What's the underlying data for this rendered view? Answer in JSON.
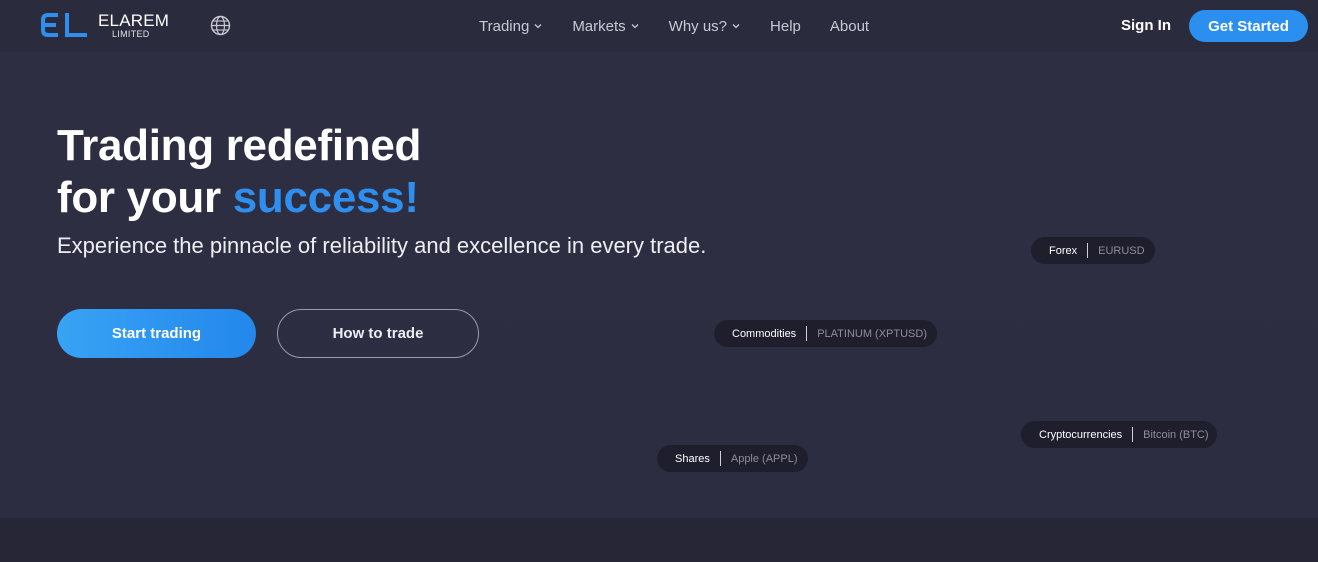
{
  "brand": {
    "name": "ELAREM",
    "sub": "LIMITED",
    "color": "#2f8fee"
  },
  "nav": {
    "items": [
      {
        "label": "Trading",
        "dropdown": true
      },
      {
        "label": "Markets",
        "dropdown": true
      },
      {
        "label": "Why us?",
        "dropdown": true
      },
      {
        "label": "Help",
        "dropdown": false
      },
      {
        "label": "About",
        "dropdown": false
      }
    ],
    "sign_in": "Sign In",
    "get_started": "Get Started",
    "language_icon": "globe-icon"
  },
  "hero": {
    "title_line1": "Trading redefined",
    "title_line2_prefix": "for your ",
    "title_line2_accent": "success!",
    "subtitle": "Experience the pinnacle of reliability and excellence in every trade.",
    "cta_primary": "Start trading",
    "cta_secondary": "How to trade"
  },
  "tags": [
    {
      "category": "Forex",
      "instrument": "EURUSD"
    },
    {
      "category": "Commodities",
      "instrument": "PLATINUM (XPTUSD)"
    },
    {
      "category": "Cryptocurrencies",
      "instrument": "Bitcoin (BTC)"
    },
    {
      "category": "Shares",
      "instrument": "Apple (APPL)"
    }
  ],
  "colors": {
    "background": "#2a2a3d",
    "accent": "#2f8fee",
    "tag_background": "#1e1e2c"
  }
}
